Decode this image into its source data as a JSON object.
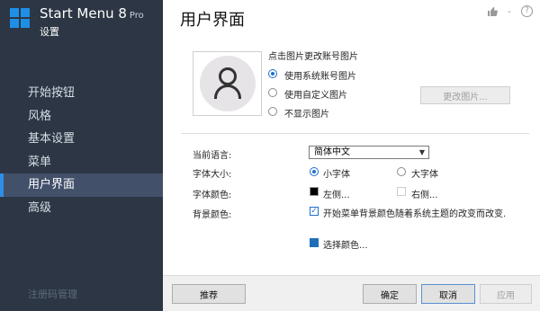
{
  "app": {
    "title": "Start Menu 8",
    "edition": "Pro",
    "subtitle": "设置",
    "logo_icon": "windows-logo-icon",
    "accent_color": "#1e8fe6"
  },
  "sidebar": {
    "items": [
      {
        "label": "开始按钮",
        "active": false
      },
      {
        "label": "风格",
        "active": false
      },
      {
        "label": "基本设置",
        "active": false
      },
      {
        "label": "菜单",
        "active": false
      },
      {
        "label": "用户界面",
        "active": true
      },
      {
        "label": "高级",
        "active": false
      }
    ],
    "register_label": "注册码管理"
  },
  "header": {
    "title": "用户界面",
    "icons": [
      "thumbs-up-icon",
      "minimize-icon",
      "help-icon"
    ],
    "minimize_glyph": "-",
    "help_glyph": "?"
  },
  "account_picture": {
    "heading": "点击图片更改账号图片",
    "options": [
      {
        "label": "使用系统账号图片",
        "selected": true
      },
      {
        "label": "使用自定义图片",
        "selected": false
      },
      {
        "label": "不显示图片",
        "selected": false
      }
    ],
    "change_button_label": "更改图片...",
    "change_button_enabled": false
  },
  "language": {
    "label": "当前语言:",
    "selected": "简体中文"
  },
  "font_size": {
    "label": "字体大小:",
    "options": [
      {
        "label": "小字体",
        "selected": true
      },
      {
        "label": "大字体",
        "selected": false
      }
    ]
  },
  "font_color": {
    "label": "字体颜色:",
    "left_label": "左侧...",
    "left_color": "#000000",
    "right_label": "右侧...",
    "right_color": "#ffffff"
  },
  "background_color": {
    "label": "背景颜色:",
    "follow_theme_label": "开始菜单背景颜色随着系统主题的改变而改变.",
    "follow_theme_checked": true,
    "choose_label": "选择颜色...",
    "choose_color": "#1f6fb8"
  },
  "footer": {
    "recommend_label": "推荐",
    "ok_label": "确定",
    "cancel_label": "取消",
    "apply_label": "应用",
    "apply_enabled": false
  }
}
